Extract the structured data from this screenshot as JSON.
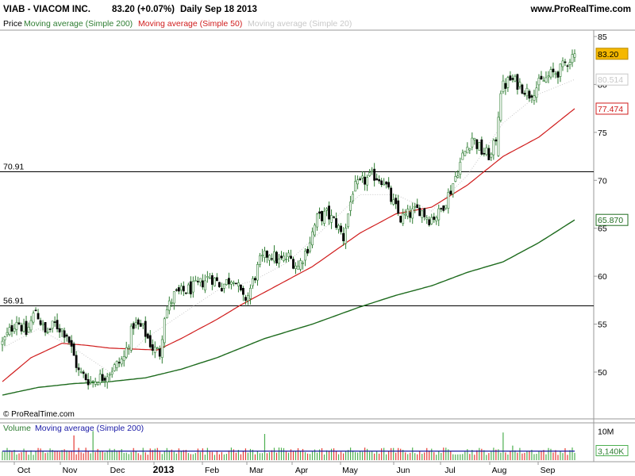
{
  "header": {
    "symbol": "VIAB - VIACOM INC.",
    "quote": "83.20 (+0.07%)",
    "period": "Daily",
    "date": "Sep 18 2013",
    "site": "www.ProRealTime.com"
  },
  "legend": {
    "price": "Price",
    "ma200": "Moving average (Simple 200)",
    "ma50": "Moving average (Simple 50)",
    "ma20": "Moving average (Simple 20)"
  },
  "copyright": "© ProRealTime.com",
  "volume_legend": {
    "volume": "Volume",
    "ma200": "Moving average (Simple 200)"
  },
  "colors": {
    "up": "#2e7d32",
    "down": "#000000",
    "ma200": "#1e6b1e",
    "ma50": "#d01c1c",
    "ma20": "#c8c8c8",
    "volume_up": "#4caf50",
    "volume_down": "#e53935",
    "volume_ma": "#1a1aa6",
    "last_price_bg": "#f5b800"
  },
  "chart_data": [
    {
      "type": "line",
      "title": "VIAB - VIACOM INC.",
      "series_kind": "candlestick",
      "x_tick_labels": [
        "Oct",
        "Nov",
        "Dec",
        "2013",
        "Feb",
        "Mar",
        "Apr",
        "May",
        "Jun",
        "Jul",
        "Aug",
        "Sep"
      ],
      "y_ticks": [
        50,
        55,
        60,
        65,
        70,
        75,
        80,
        85
      ],
      "ylim": [
        47,
        86
      ],
      "horizontal_lines": [
        {
          "label": "70.91",
          "value": 70.91
        },
        {
          "label": "56.91",
          "value": 56.91
        }
      ],
      "last_values": [
        {
          "label": "83.20",
          "value": 83.2,
          "series": "price"
        },
        {
          "label": "80.514",
          "value": 80.514,
          "series": "ma20"
        },
        {
          "label": "77.474",
          "value": 77.474,
          "series": "ma50"
        },
        {
          "label": "65.870",
          "value": 65.87,
          "series": "ma200"
        }
      ],
      "price_keypoints": [
        [
          0,
          53.0
        ],
        [
          6,
          55.5
        ],
        [
          10,
          54.0
        ],
        [
          14,
          56.5
        ],
        [
          18,
          54.0
        ],
        [
          22,
          55.0
        ],
        [
          27,
          54.0
        ],
        [
          32,
          50.0
        ],
        [
          37,
          49.0
        ],
        [
          42,
          49.5
        ],
        [
          47,
          50.5
        ],
        [
          51,
          51.5
        ],
        [
          55,
          55.0
        ],
        [
          59,
          54.5
        ],
        [
          63,
          52.5
        ],
        [
          66,
          52.0
        ],
        [
          68,
          56.0
        ],
        [
          72,
          58.0
        ],
        [
          77,
          58.5
        ],
        [
          82,
          59.0
        ],
        [
          87,
          60.0
        ],
        [
          92,
          59.0
        ],
        [
          97,
          60.0
        ],
        [
          101,
          57.5
        ],
        [
          103,
          58.0
        ],
        [
          108,
          61.5
        ],
        [
          112,
          62.5
        ],
        [
          116,
          61.5
        ],
        [
          120,
          62.0
        ],
        [
          124,
          61.0
        ],
        [
          128,
          63.0
        ],
        [
          132,
          66.0
        ],
        [
          136,
          66.5
        ],
        [
          140,
          65.5
        ],
        [
          143,
          64.0
        ],
        [
          147,
          69.0
        ],
        [
          152,
          70.0
        ],
        [
          156,
          70.5
        ],
        [
          160,
          70.0
        ],
        [
          163,
          68.0
        ],
        [
          167,
          66.0
        ],
        [
          171,
          66.5
        ],
        [
          175,
          67.0
        ],
        [
          179,
          66.0
        ],
        [
          183,
          66.5
        ],
        [
          188,
          69.0
        ],
        [
          193,
          72.5
        ],
        [
          197,
          74.5
        ],
        [
          201,
          73.0
        ],
        [
          205,
          72.5
        ],
        [
          207,
          74.5
        ],
        [
          209,
          79.5
        ],
        [
          213,
          80.5
        ],
        [
          217,
          80.0
        ],
        [
          221,
          79.0
        ],
        [
          225,
          80.0
        ],
        [
          230,
          81.0
        ],
        [
          234,
          81.5
        ],
        [
          237,
          82.5
        ],
        [
          240,
          83.2
        ]
      ],
      "ma200_keypoints": [
        [
          0,
          47.6
        ],
        [
          15,
          48.4
        ],
        [
          30,
          48.8
        ],
        [
          45,
          49.0
        ],
        [
          60,
          49.4
        ],
        [
          75,
          50.3
        ],
        [
          90,
          51.5
        ],
        [
          110,
          53.5
        ],
        [
          130,
          55.0
        ],
        [
          150,
          56.8
        ],
        [
          165,
          58.0
        ],
        [
          180,
          59.0
        ],
        [
          195,
          60.4
        ],
        [
          210,
          61.5
        ],
        [
          225,
          63.5
        ],
        [
          240,
          65.87
        ]
      ],
      "ma50_keypoints": [
        [
          0,
          49.0
        ],
        [
          12,
          51.5
        ],
        [
          25,
          53.0
        ],
        [
          35,
          52.8
        ],
        [
          45,
          52.5
        ],
        [
          55,
          52.4
        ],
        [
          65,
          52.3
        ],
        [
          75,
          53.5
        ],
        [
          90,
          55.5
        ],
        [
          100,
          57.0
        ],
        [
          115,
          59.0
        ],
        [
          130,
          61.0
        ],
        [
          150,
          64.5
        ],
        [
          165,
          66.5
        ],
        [
          180,
          67.2
        ],
        [
          195,
          69.5
        ],
        [
          210,
          72.5
        ],
        [
          225,
          74.5
        ],
        [
          240,
          77.474
        ]
      ],
      "ma20_keypoints": [
        [
          0,
          52.5
        ],
        [
          15,
          54.5
        ],
        [
          30,
          52.5
        ],
        [
          45,
          50.0
        ],
        [
          60,
          53.5
        ],
        [
          75,
          56.0
        ],
        [
          90,
          58.5
        ],
        [
          105,
          59.5
        ],
        [
          120,
          61.5
        ],
        [
          135,
          65.0
        ],
        [
          150,
          68.5
        ],
        [
          165,
          68.5
        ],
        [
          180,
          66.8
        ],
        [
          195,
          70.5
        ],
        [
          210,
          76.0
        ],
        [
          225,
          79.0
        ],
        [
          240,
          80.514
        ]
      ]
    },
    {
      "type": "bar",
      "title": "Volume",
      "y_ticks_labels": [
        "10M"
      ],
      "ylim": [
        0,
        12
      ],
      "unit": "M",
      "last_values": [
        {
          "label": "3,140K",
          "value": 3.14,
          "series": "volume"
        }
      ],
      "volume_ma200": 3.1,
      "spikes": [
        [
          30,
          8.5
        ],
        [
          38,
          10.0
        ],
        [
          110,
          9.0
        ],
        [
          210,
          9.5
        ],
        [
          214,
          5.0
        ]
      ]
    }
  ]
}
